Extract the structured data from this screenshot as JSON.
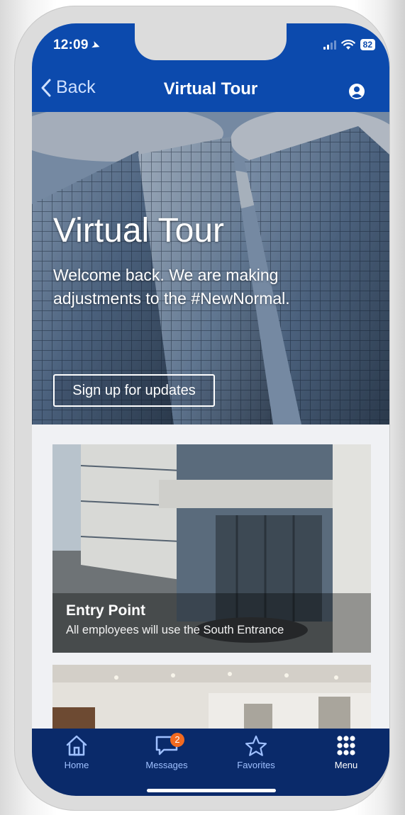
{
  "status_bar": {
    "time": "12:09",
    "battery": "82"
  },
  "navbar": {
    "back_label": "Back",
    "title": "Virtual Tour"
  },
  "hero": {
    "title": "Virtual Tour",
    "body": "Welcome back. We are making adjustments to the #NewNormal.",
    "button_label": "Sign up for updates"
  },
  "cards": [
    {
      "title": "Entry Point",
      "subtitle": "All employees will use the South Entrance"
    }
  ],
  "tabbar": {
    "items": [
      {
        "label": "Home",
        "icon": "home-icon"
      },
      {
        "label": "Messages",
        "icon": "chat-icon",
        "badge": "2"
      },
      {
        "label": "Favorites",
        "icon": "star-icon"
      },
      {
        "label": "Menu",
        "icon": "grid-icon"
      }
    ]
  },
  "colors": {
    "header": "#0c4aad",
    "tabbar": "#0a2a6a",
    "badge": "#f26a20",
    "tab_icon": "#9fc0ff"
  }
}
